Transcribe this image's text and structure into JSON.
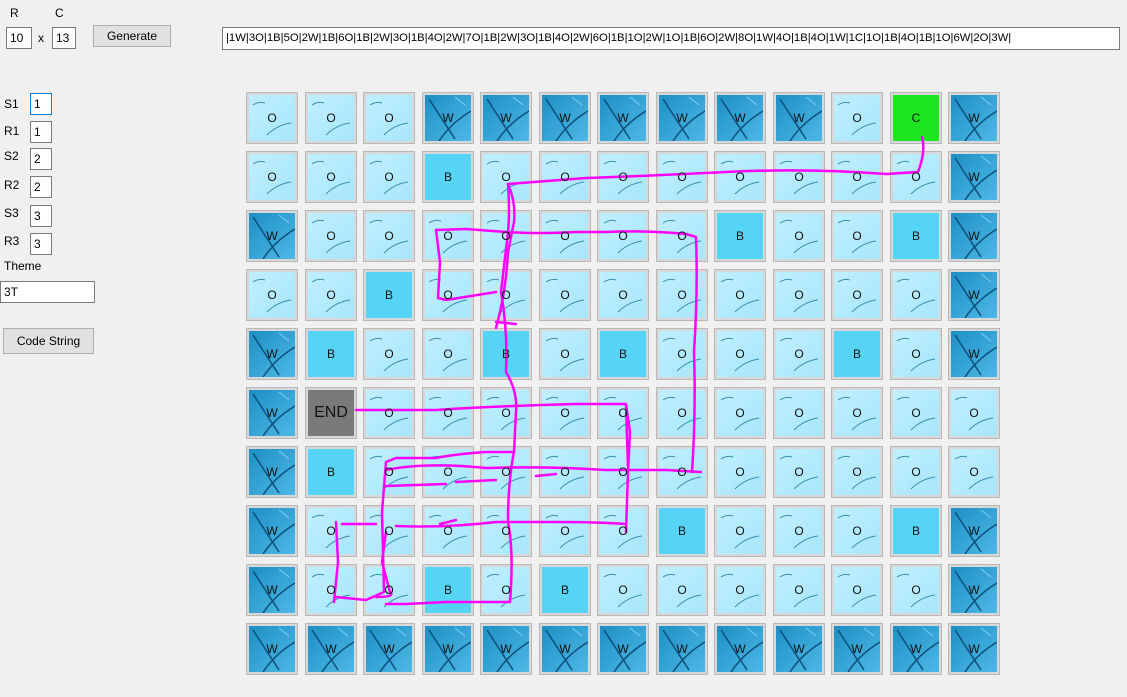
{
  "controls": {
    "rows_label": "R",
    "cols_label": "C",
    "rows_value": "10",
    "times_label": "x",
    "cols_value": "13",
    "generate_label": "Generate",
    "code_string_value": "|1W|3O|1B|5O|2W|1B|6O|1B|2W|3O|1B|4O|2W|7O|1B|2W|3O|1B|4O|2W|6O|1B|1O|2W|1O|1B|6O|2W|8O|1W|4O|1B|4O|1W|1C|1O|1B|4O|1B|1O|6W|2O|3W|",
    "s1_label": "S1",
    "s1_value": "1",
    "r1_label": "R1",
    "r1_value": "1",
    "s2_label": "S2",
    "s2_value": "2",
    "r2_label": "R2",
    "r2_value": "2",
    "s3_label": "S3",
    "s3_value": "3",
    "r3_label": "R3",
    "r3_value": "3",
    "theme_label": "Theme",
    "theme_value": "3T",
    "code_string_button": "Code String"
  },
  "grid": {
    "rows": [
      [
        "O",
        "O",
        "O",
        "W",
        "W",
        "W",
        "W",
        "W",
        "W",
        "W",
        "O",
        "C",
        "W"
      ],
      [
        "O",
        "O",
        "O",
        "B",
        "O",
        "O",
        "O",
        "O",
        "O",
        "O",
        "O",
        "O",
        "W"
      ],
      [
        "W",
        "O",
        "O",
        "O",
        "O",
        "O",
        "O",
        "O",
        "B",
        "O",
        "O",
        "B",
        "W"
      ],
      [
        "O",
        "O",
        "B",
        "O",
        "O",
        "O",
        "O",
        "O",
        "O",
        "O",
        "O",
        "O",
        "W"
      ],
      [
        "W",
        "B",
        "O",
        "O",
        "B",
        "O",
        "B",
        "O",
        "O",
        "O",
        "B",
        "O",
        "W"
      ],
      [
        "W",
        "END",
        "O",
        "O",
        "O",
        "O",
        "O",
        "O",
        "O",
        "O",
        "O",
        "O",
        "O"
      ],
      [
        "W",
        "B",
        "O",
        "O",
        "O",
        "O",
        "O",
        "O",
        "O",
        "O",
        "O",
        "O",
        "O"
      ],
      [
        "W",
        "O",
        "O",
        "O",
        "O",
        "O",
        "O",
        "B",
        "O",
        "O",
        "O",
        "B",
        "W"
      ],
      [
        "W",
        "O",
        "O",
        "B",
        "O",
        "B",
        "O",
        "O",
        "O",
        "O",
        "O",
        "O",
        "W"
      ],
      [
        "W",
        "W",
        "W",
        "W",
        "W",
        "W",
        "W",
        "W",
        "W",
        "W",
        "W",
        "W",
        "W"
      ]
    ],
    "labels": {
      "O": "O",
      "W": "W",
      "B": "B",
      "C": "C",
      "END": "END"
    }
  },
  "colors": {
    "open": "#a8e6fb",
    "wall": "#1e8fc4",
    "block": "#55d4f5",
    "start": "#1ee61e",
    "end": "#7a7a7a",
    "annotation_ink": "#ff00ff"
  }
}
